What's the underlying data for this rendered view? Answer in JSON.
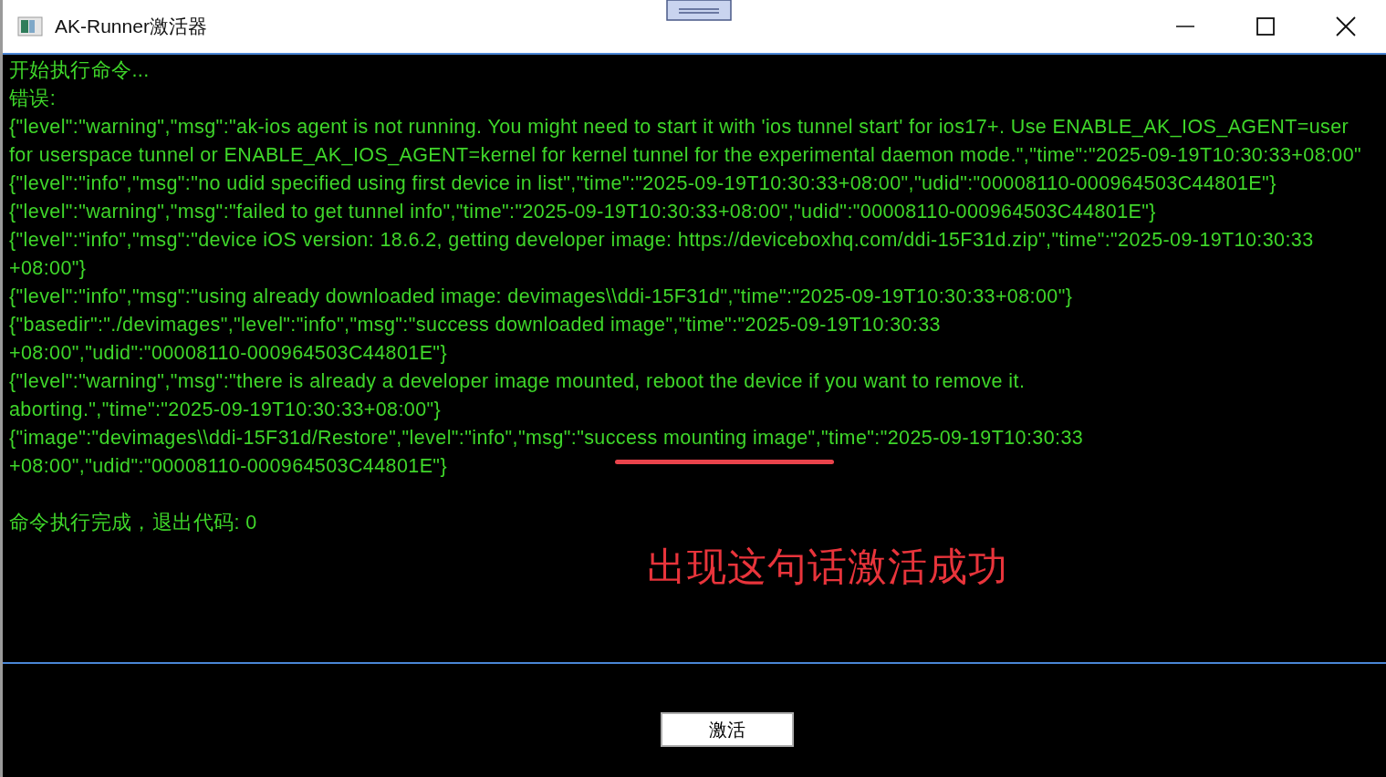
{
  "window": {
    "title": "AK-Runner激活器"
  },
  "log": {
    "lines": [
      "开始执行命令...",
      "错误:",
      "{\"level\":\"warning\",\"msg\":\"ak-ios agent is not running. You might need to start it with 'ios tunnel start' for ios17+. Use ENABLE_AK_IOS_AGENT=user",
      "for userspace tunnel or ENABLE_AK_IOS_AGENT=kernel for kernel tunnel for the experimental daemon mode.\",\"time\":\"2025-09-19T10:30:33+08:00\"",
      "{\"level\":\"info\",\"msg\":\"no udid specified using first device in list\",\"time\":\"2025-09-19T10:30:33+08:00\",\"udid\":\"00008110-000964503C44801E\"}",
      "{\"level\":\"warning\",\"msg\":\"failed to get tunnel info\",\"time\":\"2025-09-19T10:30:33+08:00\",\"udid\":\"00008110-000964503C44801E\"}",
      "{\"level\":\"info\",\"msg\":\"device iOS version: 18.6.2, getting developer image: https://deviceboxhq.com/ddi-15F31d.zip\",\"time\":\"2025-09-19T10:30:33",
      "+08:00\"}",
      "{\"level\":\"info\",\"msg\":\"using already downloaded image: devimages\\\\ddi-15F31d\",\"time\":\"2025-09-19T10:30:33+08:00\"}",
      "{\"basedir\":\"./devimages\",\"level\":\"info\",\"msg\":\"success downloaded image\",\"time\":\"2025-09-19T10:30:33",
      "+08:00\",\"udid\":\"00008110-000964503C44801E\"}",
      "{\"level\":\"warning\",\"msg\":\"there is already a developer image mounted, reboot the device if you want to remove it.",
      "aborting.\",\"time\":\"2025-09-19T10:30:33+08:00\"}",
      "{\"image\":\"devimages\\\\ddi-15F31d/Restore\",\"level\":\"info\",\"msg\":\"success mounting image\",\"time\":\"2025-09-19T10:30:33",
      "+08:00\",\"udid\":\"00008110-000964503C44801E\"}"
    ],
    "result": "命令执行完成，退出代码: 0"
  },
  "annotation": {
    "text": "出现这句话激活成功"
  },
  "button": {
    "label": "激活"
  }
}
